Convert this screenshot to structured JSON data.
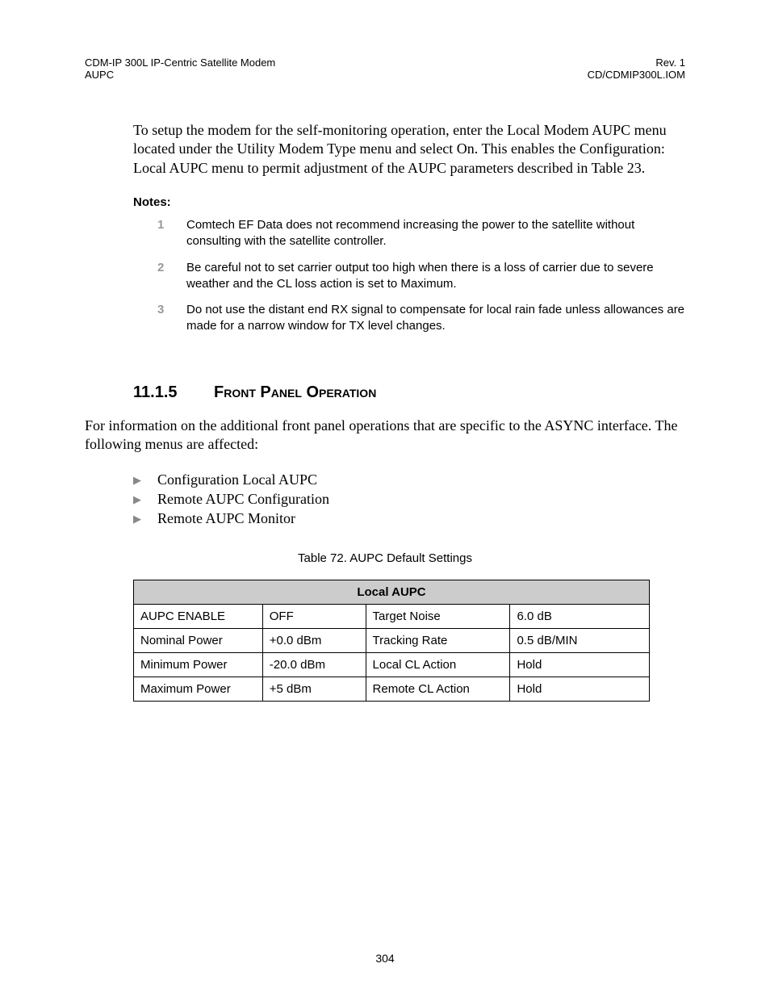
{
  "header": {
    "left_line1": "CDM-IP 300L IP-Centric Satellite Modem",
    "left_line2": "AUPC",
    "right_line1": "Rev. 1",
    "right_line2": "CD/CDMIP300L.IOM"
  },
  "intro": "To setup the modem for the self-monitoring operation, enter the Local Modem AUPC menu located under the Utility Modem Type menu and select On. This enables the Configuration: Local AUPC menu to permit adjustment of the AUPC parameters described in Table 23.",
  "notes_label": "Notes:",
  "notes": [
    {
      "num": "1",
      "text": "Comtech EF Data does not recommend increasing the power to the satellite without consulting with the satellite controller."
    },
    {
      "num": "2",
      "text": "Be careful not to set carrier output too high when there is a loss of carrier due to severe weather and the CL loss action is set to Maximum."
    },
    {
      "num": "3",
      "text": "Do not use the distant end RX signal to compensate for local rain fade unless allowances are made for a narrow window for TX level changes."
    }
  ],
  "section": {
    "num": "11.1.5",
    "title": "Front Panel Operation"
  },
  "body_para": "For information on the additional front panel operations that are specific to the ASYNC interface. The following menus are affected:",
  "bullets": [
    "Configuration Local AUPC",
    "Remote AUPC Configuration",
    "Remote AUPC Monitor"
  ],
  "table": {
    "caption": "Table 72.  AUPC Default Settings",
    "header": "Local AUPC",
    "rows": [
      {
        "c1": "AUPC ENABLE",
        "c2": "OFF",
        "c3": "Target Noise",
        "c4": "6.0 dB"
      },
      {
        "c1": "Nominal Power",
        "c2": "+0.0 dBm",
        "c3": "Tracking Rate",
        "c4": "0.5 dB/MIN"
      },
      {
        "c1": "Minimum Power",
        "c2": "-20.0 dBm",
        "c3": "Local CL Action",
        "c4": "Hold"
      },
      {
        "c1": "Maximum Power",
        "c2": "+5 dBm",
        "c3": "Remote CL Action",
        "c4": "Hold"
      }
    ]
  },
  "page_num": "304"
}
